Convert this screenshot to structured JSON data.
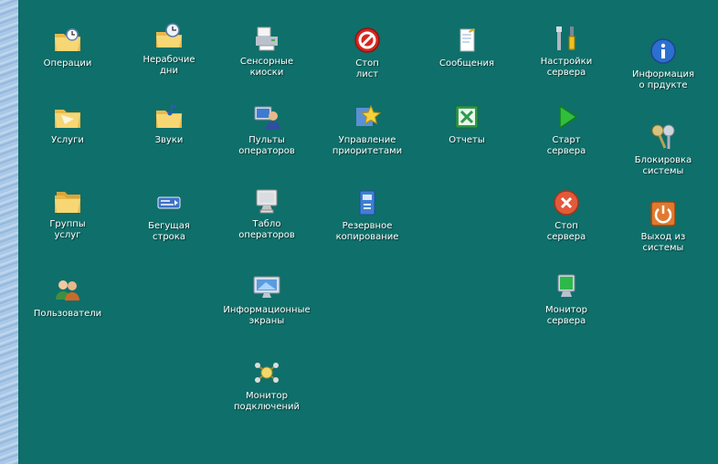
{
  "desktop": {
    "items": [
      {
        "label": "Операции",
        "icon": "folder-clock-icon"
      },
      {
        "label": "Нерабочие\nдни",
        "icon": "folder-clock-icon"
      },
      {
        "label": "Сенсорные\nкиоски",
        "icon": "kiosk-printer-icon"
      },
      {
        "label": "Стоп\nлист",
        "icon": "stop-sign-icon"
      },
      {
        "label": "Сообщения",
        "icon": "notepad-icon"
      },
      {
        "label": "Настройки\nсервера",
        "icon": "tools-icon"
      },
      {
        "label": "Информация\nо прдукте",
        "icon": "info-icon"
      },
      {
        "label": "Услуги",
        "icon": "folder-icon"
      },
      {
        "label": "Звуки",
        "icon": "music-folder-icon"
      },
      {
        "label": "Пульты\nоператоров",
        "icon": "operator-console-icon"
      },
      {
        "label": "Управление\nприоритетами",
        "icon": "priority-star-icon"
      },
      {
        "label": "Отчеты",
        "icon": "excel-report-icon"
      },
      {
        "label": "Старт\nсервера",
        "icon": "play-icon"
      },
      {
        "label": "Блокировка\nсистемы",
        "icon": "keys-icon"
      },
      {
        "label": "Группы\nуслуг",
        "icon": "folder-group-icon"
      },
      {
        "label": "Бегущая\nстрока",
        "icon": "ticker-icon"
      },
      {
        "label": "Табло\nоператоров",
        "icon": "monitor-icon"
      },
      {
        "label": "Резервное\nкопирование",
        "icon": "backup-icon"
      },
      {
        "label": "Стоп\nсервера",
        "icon": "close-circle-icon"
      },
      {
        "label": "Выход из\nсистемы",
        "icon": "power-icon"
      },
      {
        "label": "Пользователи",
        "icon": "users-icon"
      },
      {
        "label": "Информационные\nэкраны",
        "icon": "info-screen-icon"
      },
      {
        "label": "Монитор\nсервера",
        "icon": "server-monitor-icon"
      },
      {
        "label": "Монитор\nподключений",
        "icon": "network-icon"
      }
    ]
  }
}
